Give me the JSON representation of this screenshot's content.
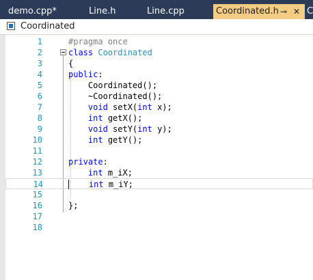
{
  "tabs": [
    {
      "label": "demo.cpp*"
    },
    {
      "label": "Line.h"
    },
    {
      "label": "Line.cpp"
    },
    {
      "label": "Coordinated.h",
      "active": true,
      "pin_icon": "pin-icon",
      "close_icon": "close-icon"
    },
    {
      "label": "C"
    }
  ],
  "navbar": {
    "icon": "class-icon",
    "label": "Coordinated"
  },
  "colors": {
    "tabbar": "#2b3b58",
    "active_tab": "#f5cc84",
    "keyword": "#0000ff",
    "type": "#2b91af",
    "preprocessor": "#808080",
    "line_number": "#2b91af"
  },
  "lines": [
    {
      "n": "1",
      "parts": [
        {
          "t": "#pragma once",
          "c": "pp"
        }
      ]
    },
    {
      "n": "2",
      "parts": [
        {
          "t": "class ",
          "c": "kw"
        },
        {
          "t": "Coordinated",
          "c": "ty"
        }
      ]
    },
    {
      "n": "3",
      "parts": [
        {
          "t": "{",
          "c": ""
        }
      ]
    },
    {
      "n": "4",
      "parts": [
        {
          "t": "public",
          "c": "kw"
        },
        {
          "t": ":",
          "c": ""
        }
      ]
    },
    {
      "n": "5",
      "parts": [
        {
          "t": "    Coordinated();",
          "c": ""
        }
      ]
    },
    {
      "n": "6",
      "parts": [
        {
          "t": "    ~Coordinated();",
          "c": ""
        }
      ]
    },
    {
      "n": "7",
      "parts": [
        {
          "t": "    ",
          "c": ""
        },
        {
          "t": "void",
          "c": "kw"
        },
        {
          "t": " setX(",
          "c": ""
        },
        {
          "t": "int",
          "c": "kw"
        },
        {
          "t": " x);",
          "c": ""
        }
      ]
    },
    {
      "n": "8",
      "parts": [
        {
          "t": "    ",
          "c": ""
        },
        {
          "t": "int",
          "c": "kw"
        },
        {
          "t": " getX();",
          "c": ""
        }
      ]
    },
    {
      "n": "9",
      "parts": [
        {
          "t": "    ",
          "c": ""
        },
        {
          "t": "void",
          "c": "kw"
        },
        {
          "t": " setY(",
          "c": ""
        },
        {
          "t": "int",
          "c": "kw"
        },
        {
          "t": " y);",
          "c": ""
        }
      ]
    },
    {
      "n": "10",
      "parts": [
        {
          "t": "    ",
          "c": ""
        },
        {
          "t": "int",
          "c": "kw"
        },
        {
          "t": " getY();",
          "c": ""
        }
      ]
    },
    {
      "n": "11",
      "parts": []
    },
    {
      "n": "12",
      "parts": [
        {
          "t": "private",
          "c": "kw"
        },
        {
          "t": ":",
          "c": ""
        }
      ]
    },
    {
      "n": "13",
      "parts": [
        {
          "t": "    ",
          "c": ""
        },
        {
          "t": "int",
          "c": "kw"
        },
        {
          "t": " m_iX;",
          "c": ""
        }
      ]
    },
    {
      "n": "14",
      "parts": [
        {
          "t": "    ",
          "c": ""
        },
        {
          "t": "int",
          "c": "kw"
        },
        {
          "t": " m_iY;",
          "c": ""
        }
      ],
      "current": true
    },
    {
      "n": "15",
      "parts": []
    },
    {
      "n": "16",
      "parts": [
        {
          "t": "};",
          "c": ""
        }
      ]
    },
    {
      "n": "17",
      "parts": []
    },
    {
      "n": "18",
      "parts": []
    }
  ]
}
